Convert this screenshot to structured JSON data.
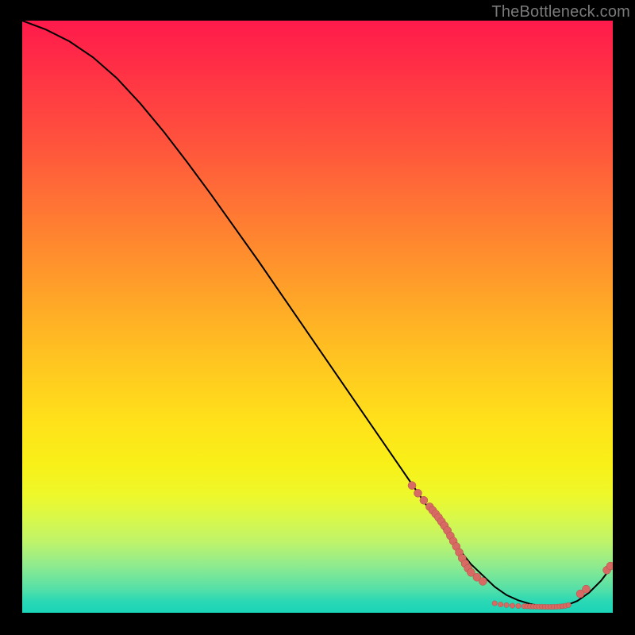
{
  "watermark": "TheBottleneck.com",
  "colors": {
    "background": "#000000",
    "curve": "#000000",
    "dot_fill": "#d76a63",
    "dot_stroke": "#b24f49"
  },
  "chart_data": {
    "type": "line",
    "title": "",
    "xlabel": "",
    "ylabel": "",
    "xlim": [
      0,
      100
    ],
    "ylim": [
      0,
      100
    ],
    "series": [
      {
        "name": "curve",
        "x": [
          0,
          4,
          8,
          12,
          16,
          20,
          24,
          28,
          32,
          36,
          40,
          44,
          48,
          52,
          56,
          60,
          64,
          68,
          72,
          76,
          80,
          82,
          84,
          86,
          88,
          90,
          92,
          94,
          96,
          98,
          100
        ],
        "y": [
          100,
          98.5,
          96.5,
          93.8,
          90.3,
          86.0,
          81.2,
          76.0,
          70.6,
          65.0,
          59.4,
          53.6,
          47.8,
          42.0,
          36.2,
          30.4,
          24.6,
          18.8,
          13.2,
          8.2,
          4.4,
          3.0,
          2.1,
          1.5,
          1.1,
          1.0,
          1.2,
          2.0,
          3.4,
          5.4,
          8.0
        ]
      }
    ],
    "points_cluster_left": {
      "name": "cluster-left",
      "x": [
        66,
        67,
        68,
        69,
        69.5,
        70,
        70.5,
        71,
        71.5,
        72,
        72.5,
        73,
        73.5,
        74,
        74.5,
        75,
        75.5,
        76,
        77,
        78
      ],
      "y": [
        21.5,
        20.2,
        19.0,
        17.9,
        17.3,
        16.7,
        16.1,
        15.4,
        14.7,
        13.9,
        13.0,
        12.1,
        11.2,
        10.2,
        9.2,
        8.3,
        7.5,
        6.8,
        6.0,
        5.3
      ]
    },
    "points_flat": {
      "name": "flat",
      "x": [
        80,
        81,
        82,
        83,
        84,
        85,
        85.5,
        86,
        86.5,
        87,
        87.5,
        88,
        88.5,
        89,
        89.5,
        90,
        90.5,
        91,
        91.5,
        92,
        92.5
      ],
      "y": [
        1.6,
        1.4,
        1.3,
        1.2,
        1.15,
        1.1,
        1.08,
        1.06,
        1.05,
        1.04,
        1.03,
        1.02,
        1.01,
        1.0,
        1.0,
        1.01,
        1.03,
        1.06,
        1.1,
        1.18,
        1.3
      ]
    },
    "points_right": {
      "name": "right",
      "x": [
        94.5,
        95.5,
        99.0,
        99.6
      ],
      "y": [
        3.2,
        4.0,
        7.2,
        7.9
      ]
    }
  }
}
